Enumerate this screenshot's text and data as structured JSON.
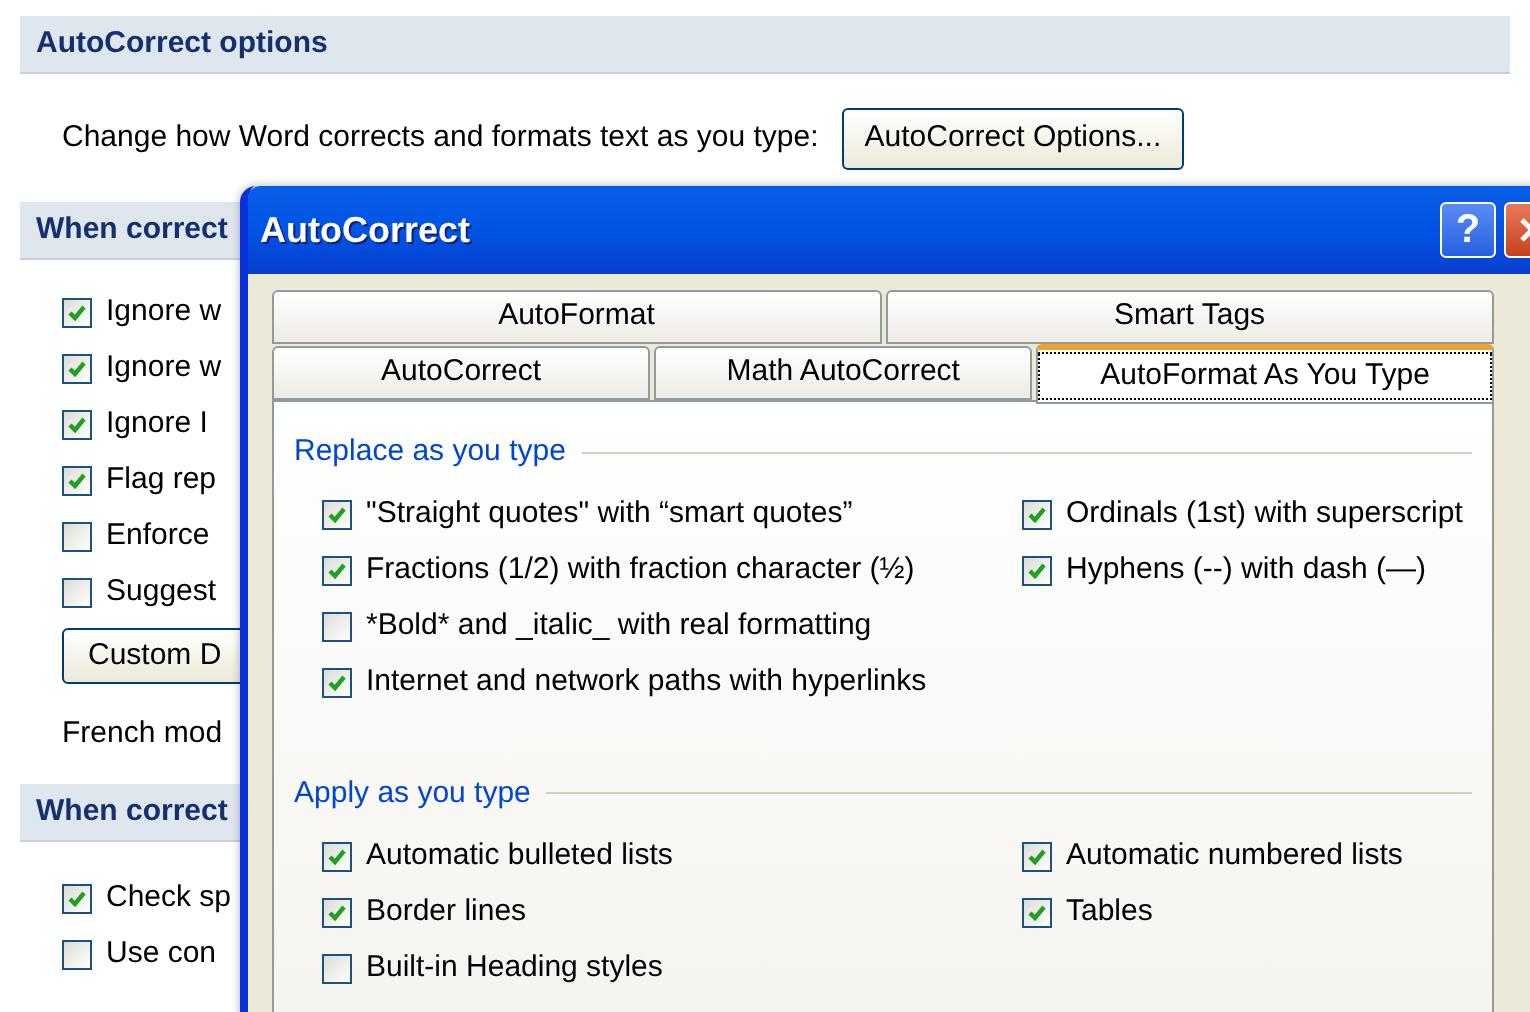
{
  "options_page": {
    "autocorrect_section": {
      "heading": "AutoCorrect options",
      "description": "Change how Word corrects and formats text as you type:",
      "button": "AutoCorrect Options..."
    },
    "correcting_section": {
      "heading": "When correct",
      "checkboxes": [
        {
          "label": "Ignore w",
          "checked": true
        },
        {
          "label": "Ignore w",
          "checked": true
        },
        {
          "label": "Ignore I",
          "checked": true
        },
        {
          "label": "Flag rep",
          "checked": true
        },
        {
          "label": "Enforce",
          "checked": false
        },
        {
          "label": "Suggest",
          "checked": false
        }
      ],
      "button": "Custom D",
      "mode_label": "French mod"
    },
    "spelling_section": {
      "heading": "When correct",
      "checkboxes": [
        {
          "label": "Check sp",
          "checked": true
        },
        {
          "label": "Use con",
          "checked": false
        }
      ]
    }
  },
  "dialog": {
    "title": "AutoCorrect",
    "help_button": "?",
    "tab_rows": [
      [
        {
          "label": "AutoFormat",
          "selected": false
        },
        {
          "label": "Smart Tags",
          "selected": false
        }
      ],
      [
        {
          "label": "AutoCorrect",
          "selected": false
        },
        {
          "label": "Math AutoCorrect",
          "selected": false
        },
        {
          "label": "AutoFormat As You Type",
          "selected": true
        }
      ]
    ],
    "groups": [
      {
        "title": "Replace as you type",
        "left": [
          {
            "label": "\"Straight quotes\" with “smart quotes”",
            "checked": true
          },
          {
            "label": "Fractions (1/2) with fraction character (½)",
            "checked": true
          },
          {
            "label": "*Bold* and _italic_ with real formatting",
            "checked": false
          },
          {
            "label": "Internet and network paths with hyperlinks",
            "checked": true
          }
        ],
        "right": [
          {
            "label": "Ordinals (1st) with superscript",
            "checked": true
          },
          {
            "label": "Hyphens (--) with dash (—)",
            "checked": true
          }
        ]
      },
      {
        "title": "Apply as you type",
        "left": [
          {
            "label": "Automatic bulleted lists",
            "checked": true
          },
          {
            "label": "Border lines",
            "checked": true
          },
          {
            "label": "Built-in Heading styles",
            "checked": false
          }
        ],
        "right": [
          {
            "label": "Automatic numbered lists",
            "checked": true
          },
          {
            "label": "Tables",
            "checked": true
          }
        ]
      }
    ]
  }
}
